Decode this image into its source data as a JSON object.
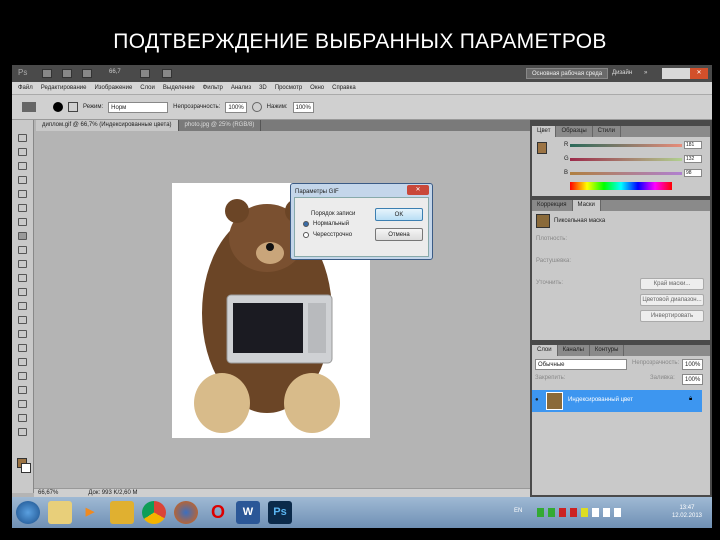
{
  "slide_title": "ПОДТВЕРЖДЕНИЕ ВЫБРАННЫХ ПАРАМЕТРОВ",
  "topbar": {
    "app_icon": "Ps",
    "zoom": "66,7",
    "workspace": "Основная рабочая среда",
    "design": "Дизайн",
    "more": "»",
    "close": "✕"
  },
  "menu": [
    "Файл",
    "Редактирование",
    "Изображение",
    "Слои",
    "Выделение",
    "Фильтр",
    "Анализ",
    "3D",
    "Просмотр",
    "Окно",
    "Справка"
  ],
  "options": {
    "mode_label": "Режим:",
    "mode_value": "Норм",
    "opacity_label": "Непрозрачность:",
    "opacity_value": "100%",
    "flow_label": "Нажим:",
    "flow_value": "100%"
  },
  "tabs": [
    "диплом.gif @ 66,7% (Индексированные цвета)",
    "photo.jpg @ 25% (RGB/8)"
  ],
  "status": {
    "zoom": "66,67%",
    "doc": "Док: 993 K/2,60 M"
  },
  "dialog": {
    "title": "Параметры GIF",
    "group": "Порядок записи",
    "opt1": "Нормальный",
    "opt2": "Чересстрочно",
    "ok": "OK",
    "cancel": "Отмена"
  },
  "color_panel": {
    "tabs": [
      "Цвет",
      "Образцы",
      "Стили"
    ],
    "r": "181",
    "g": "132",
    "b": "98"
  },
  "adjust_panel": {
    "tabs": [
      "Коррекция",
      "Маски"
    ],
    "item": "Пиксельная маска",
    "density": "Плотность:",
    "feather": "Растушевка:",
    "refine": "Уточнить:",
    "b1": "Край маски...",
    "b2": "Цветовой диапазон...",
    "b3": "Инвертировать"
  },
  "layers_panel": {
    "tabs": [
      "Слои",
      "Каналы",
      "Контуры"
    ],
    "blend": "Обычные",
    "opacity_label": "Непрозрачность:",
    "opacity": "100%",
    "lock_label": "Закрепить:",
    "fill_label": "Заливка:",
    "fill": "100%",
    "layer": "Индексированный цвет"
  },
  "taskbar": {
    "lang": "EN",
    "time": "13:47",
    "date": "12.02.2013",
    "apps": [
      "W",
      "Ps"
    ]
  }
}
